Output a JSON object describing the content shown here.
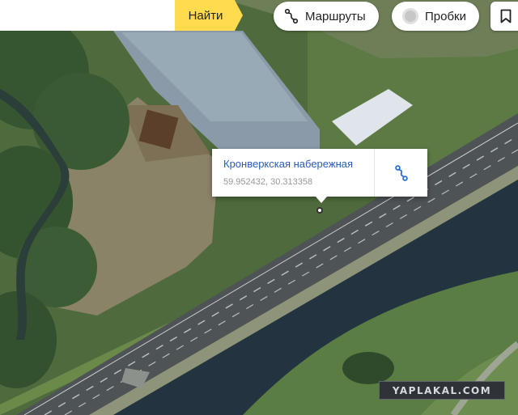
{
  "search": {
    "value": "",
    "placeholder": "",
    "button_label": "Найти"
  },
  "controls": {
    "routes_label": "Маршруты",
    "traffic_label": "Пробки",
    "routes_icon": "route-icon",
    "traffic_icon": "traffic-light-icon",
    "bookmark_icon": "bookmark-icon"
  },
  "balloon": {
    "title": "Кронверкская набережная",
    "coordinates": "59.952432, 30.313358",
    "action_icon": "route-to-icon"
  },
  "watermark": {
    "text": "YAPLAKAL.COM"
  },
  "colors": {
    "search_button": "#ffdb4d",
    "link": "#2a5bb5",
    "route_icon": "#2c6fd6",
    "river": "#233440",
    "road": "#4e5356"
  }
}
